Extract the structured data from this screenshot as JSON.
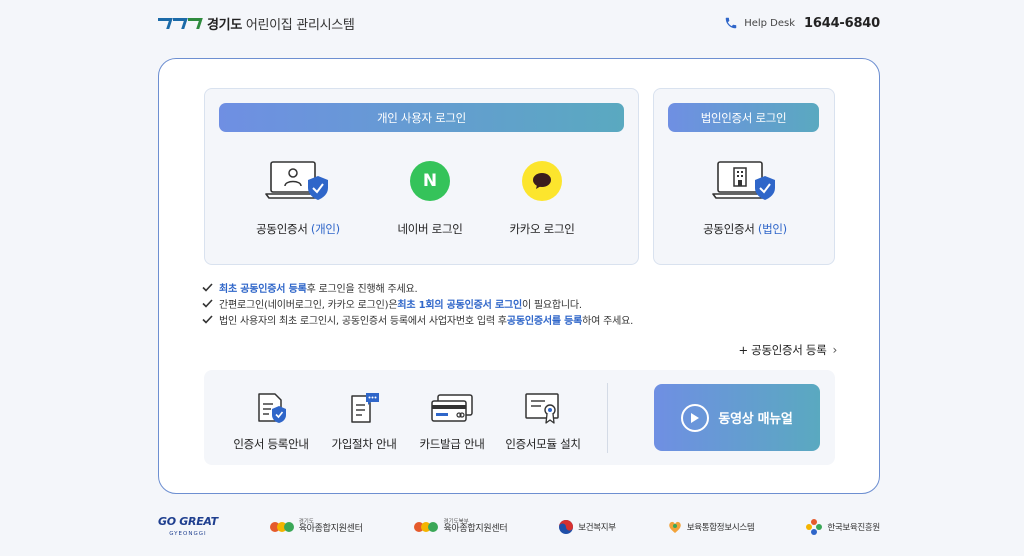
{
  "header": {
    "title_bold": "경기도",
    "title_rest": " 어린이집 관리시스템",
    "help_label": "Help Desk",
    "help_number": "1644-6840"
  },
  "personal": {
    "heading": "개인 사용자 로그인",
    "options": [
      {
        "prefix": "공동인증서 ",
        "highlight": "(개인)"
      },
      {
        "prefix": "네이버 로그인",
        "highlight": ""
      },
      {
        "prefix": "카카오 로그인",
        "highlight": ""
      }
    ],
    "naver_letter": "N"
  },
  "corporate": {
    "heading": "법인인증서 로그인",
    "option": {
      "prefix": "공동인증서 ",
      "highlight": "(법인)"
    }
  },
  "notes": [
    {
      "hl1": "최초 공동인증서 등록",
      "t1": " 후 로그인을 진행해 주세요.",
      "hl2": "",
      "t2": ""
    },
    {
      "hl1": "",
      "t1": "간편로그인(네이버로그인, 카카오 로그인)은 ",
      "hl2": "최초 1회의 공동인증서 로그인",
      "t2": " 이 필요합니다."
    },
    {
      "hl1": "",
      "t1": "법인 사용자의 최초 로그인시, 공동인증서 등록에서 사업자번호 입력 후 ",
      "hl2": "공동인증서를 등록",
      "t2": "하여 주세요."
    }
  ],
  "register_link": "+ 공동인증서 등록",
  "guides": [
    {
      "label": "인증서 등록안내"
    },
    {
      "label": "가입절차 안내"
    },
    {
      "label": "카드발급 안내"
    },
    {
      "label": "인증서모듈 설치"
    }
  ],
  "video_button": "동영상 매뉴얼",
  "footer": {
    "gogreat_main": "GO GREAT",
    "gogreat_sub": "GYEONGGI",
    "center1_small": "경기도",
    "center1_main": "육아종합지원센터",
    "center2_small": "경기도북부",
    "center2_main": "육아종합지원센터",
    "ministry": "보건복지부",
    "info_system": "보육통합정보시스템",
    "kcpi": "한국보육진흥원"
  },
  "colors": {
    "accent": "#2f66c9",
    "gradient_start": "#6f8fe3",
    "gradient_end": "#5aa9c0",
    "naver": "#35c35a",
    "kakao": "#fce52d",
    "card_border": "#6d8fd1"
  }
}
